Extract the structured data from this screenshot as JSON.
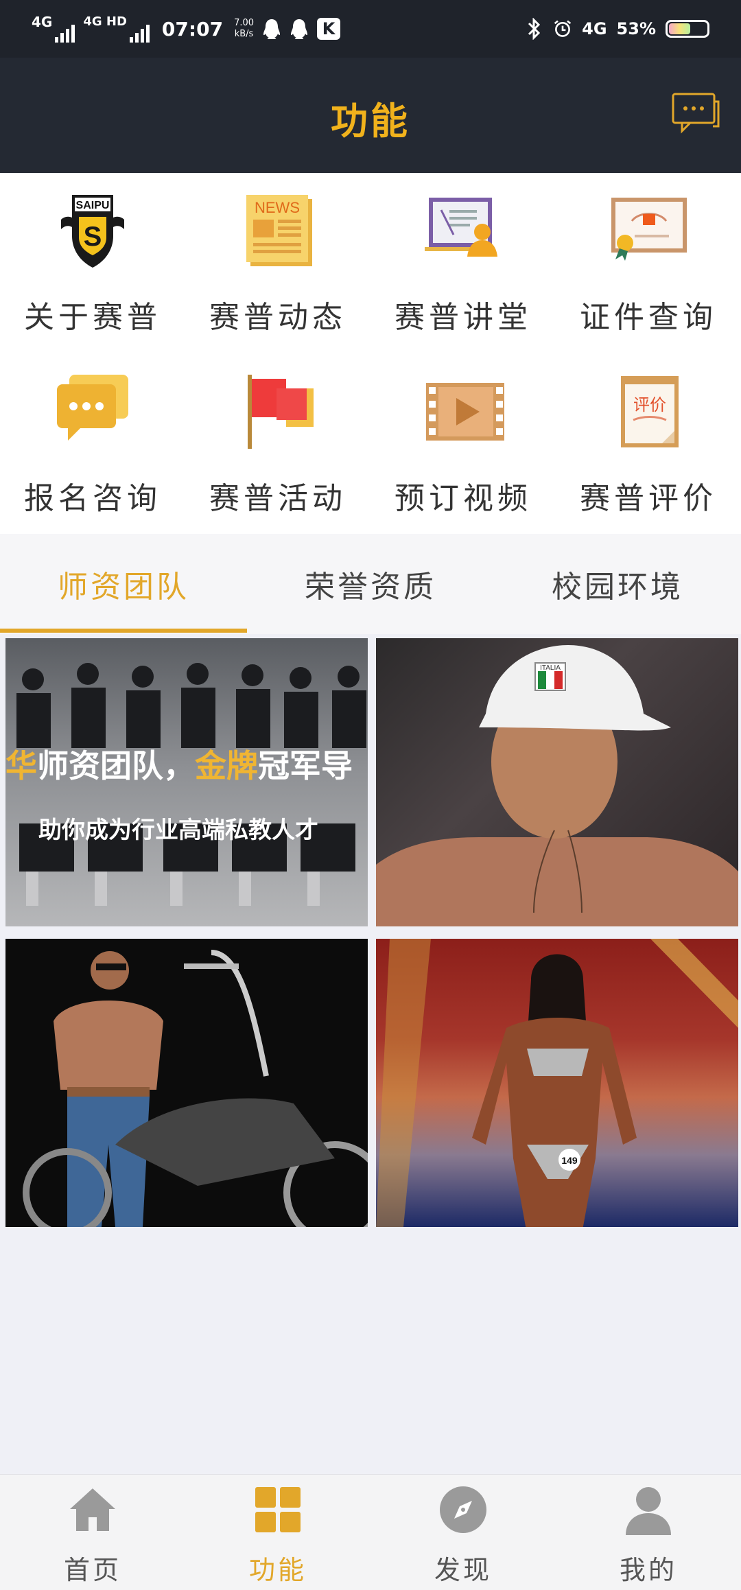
{
  "status_bar": {
    "signal1": "4G",
    "signal2": "4G HD",
    "time": "07:07",
    "speed_value": "7.00",
    "speed_unit": "kB/s",
    "network": "4G",
    "battery": "53%",
    "battery_level": 0.53
  },
  "header": {
    "title": "功能",
    "chat_icon": "chat-bubble-icon"
  },
  "functions": [
    {
      "label": "关于赛普",
      "icon": "saipu-logo-icon",
      "logo_text": "SAIPU"
    },
    {
      "label": "赛普动态",
      "icon": "news-icon",
      "icon_text": "NEWS"
    },
    {
      "label": "赛普讲堂",
      "icon": "lecture-icon"
    },
    {
      "label": "证件查询",
      "icon": "certificate-icon"
    },
    {
      "label": "报名咨询",
      "icon": "consult-chat-icon"
    },
    {
      "label": "赛普活动",
      "icon": "flag-icon"
    },
    {
      "label": "预订视频",
      "icon": "video-film-icon"
    },
    {
      "label": "赛普评价",
      "icon": "review-icon",
      "icon_text": "评价"
    }
  ],
  "tabs": [
    {
      "label": "师资团队",
      "active": true
    },
    {
      "label": "荣誉资质",
      "active": false
    },
    {
      "label": "校园环境",
      "active": false
    }
  ],
  "photos": [
    {
      "title_prefix": "华",
      "title_mid": "师资团队，",
      "title_gold": "金牌",
      "title_end": "冠军导",
      "subtitle": "助你成为行业高端私教人才"
    },
    {
      "cap_text": "ITALIA"
    },
    {},
    {
      "bib_number": "149"
    }
  ],
  "bottom_nav": [
    {
      "label": "首页",
      "icon": "home-icon",
      "active": false
    },
    {
      "label": "功能",
      "icon": "grid-icon",
      "active": true
    },
    {
      "label": "发现",
      "icon": "compass-icon",
      "active": false
    },
    {
      "label": "我的",
      "icon": "user-icon",
      "active": false
    }
  ],
  "colors": {
    "accent": "#e2a72a",
    "header_bg": "#242933",
    "title": "#f1b21c"
  }
}
